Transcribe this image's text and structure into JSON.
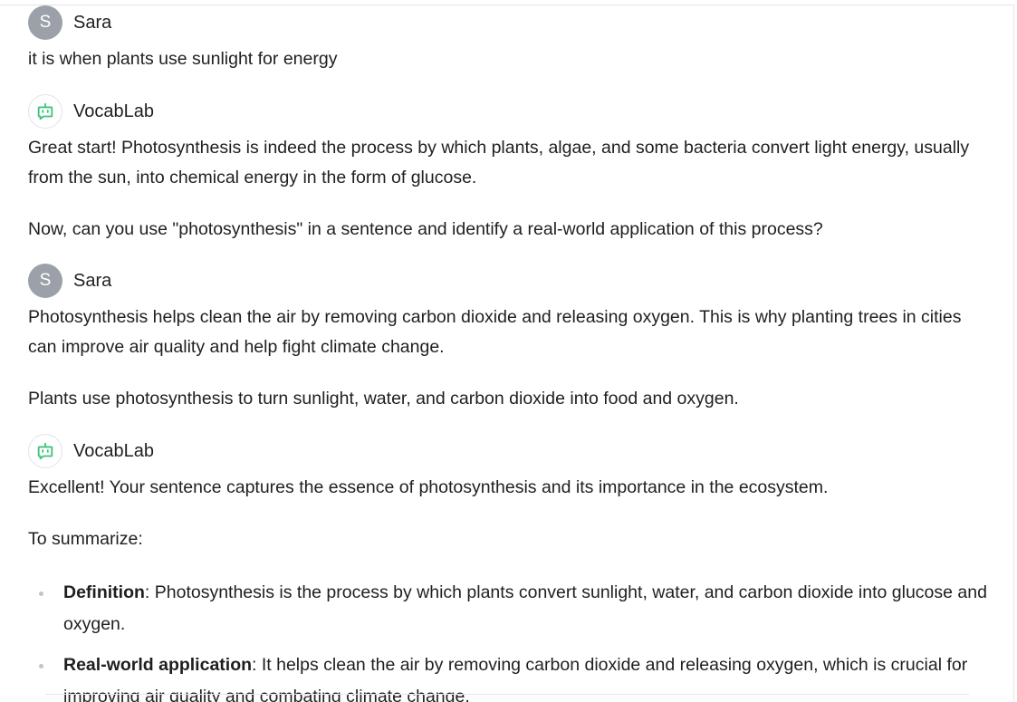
{
  "conversation": {
    "messages": [
      {
        "sender": "Sara",
        "avatar_initial": "S",
        "paragraphs": [
          "it is when plants use sunlight for energy"
        ]
      },
      {
        "sender": "VocabLab",
        "avatar_icon": "bot-icon",
        "paragraphs": [
          "Great start! Photosynthesis is indeed the process by which plants, algae, and some bacteria convert light energy, usually from the sun, into chemical energy in the form of glucose.",
          "Now, can you use \"photosynthesis\" in a sentence and identify a real-world application of this process?"
        ]
      },
      {
        "sender": "Sara",
        "avatar_initial": "S",
        "paragraphs": [
          "Photosynthesis helps clean the air by removing carbon dioxide and releasing oxygen. This is why planting trees in cities can improve air quality and help fight climate change.",
          "Plants use photosynthesis to turn sunlight, water, and carbon dioxide into food and oxygen."
        ]
      },
      {
        "sender": "VocabLab",
        "avatar_icon": "bot-icon",
        "paragraphs": [
          "Excellent! Your sentence captures the essence of photosynthesis and its importance in the ecosystem.",
          "To summarize:"
        ],
        "list": [
          {
            "term": "Definition",
            "text": ": Photosynthesis is the process by which plants convert sunlight, water, and carbon dioxide into glucose and oxygen."
          },
          {
            "term": "Real-world application",
            "text": ": It helps clean the air by removing carbon dioxide and releasing oxygen, which is crucial for improving air quality and combating climate change."
          }
        ]
      }
    ]
  },
  "colors": {
    "user_avatar_bg": "#9ca0a8",
    "bot_icon": "#3cc47c",
    "text": "#1f1f1f"
  }
}
